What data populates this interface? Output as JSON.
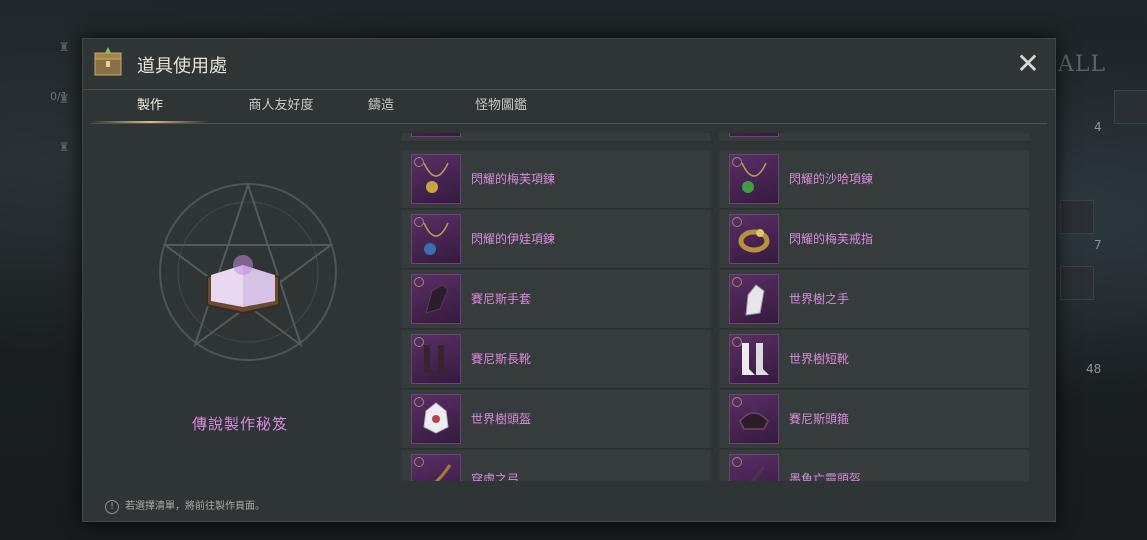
{
  "window": {
    "title": "道具使用處",
    "close_glyph": "✕"
  },
  "tabs": [
    {
      "label": "製作",
      "active": true
    },
    {
      "label": "商人友好度",
      "active": false
    },
    {
      "label": "鑄造",
      "active": false
    },
    {
      "label": "怪物圖鑑",
      "active": false
    }
  ],
  "recipe": {
    "name": "傳說製作秘笈"
  },
  "items": [
    [
      {
        "name": "閃耀的梅芙項鍊",
        "icon": "necklace-icon"
      },
      {
        "name": "閃耀的沙哈項鍊",
        "icon": "necklace-icon"
      }
    ],
    [
      {
        "name": "閃耀的伊娃項鍊",
        "icon": "necklace-icon"
      },
      {
        "name": "閃耀的梅芙戒指",
        "icon": "ring-icon"
      }
    ],
    [
      {
        "name": "賽尼斯手套",
        "icon": "gloves-icon"
      },
      {
        "name": "世界樹之手",
        "icon": "gloves-icon"
      }
    ],
    [
      {
        "name": "賽尼斯長靴",
        "icon": "boots-icon"
      },
      {
        "name": "世界樹短靴",
        "icon": "boots-icon"
      }
    ],
    [
      {
        "name": "世界樹頭盔",
        "icon": "helmet-icon"
      },
      {
        "name": "賽尼斯頭箍",
        "icon": "helmet-icon"
      }
    ],
    [
      {
        "name": "穿虛之弓",
        "icon": "bow-icon"
      },
      {
        "name": "墨魚亡靈頭盔",
        "icon": "helmet-icon"
      }
    ]
  ],
  "footer": {
    "info_glyph": "!",
    "hint": "若選擇清單，將前往製作頁面。"
  },
  "background": {
    "left_counter": "0/1",
    "right_label": "ALL",
    "right_numbers": [
      "4",
      "7",
      "48"
    ]
  },
  "colors": {
    "item_text": "#d88bdc",
    "panel": "#2f3434",
    "tab_underline": "#d7bd83"
  }
}
